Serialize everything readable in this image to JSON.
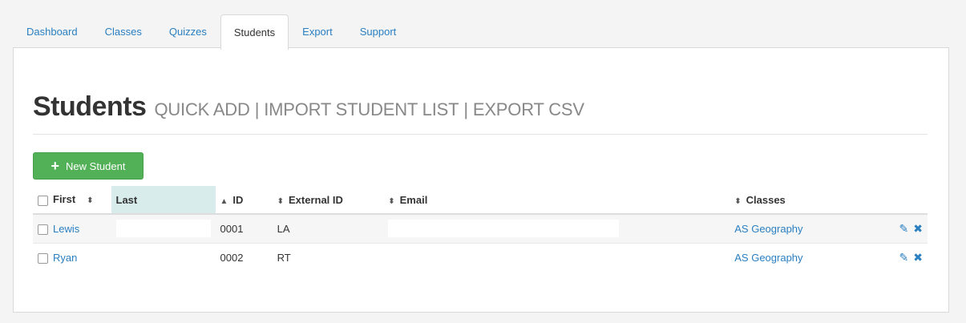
{
  "nav": {
    "tabs": [
      {
        "label": "Dashboard"
      },
      {
        "label": "Classes"
      },
      {
        "label": "Quizzes"
      },
      {
        "label": "Students"
      },
      {
        "label": "Export"
      },
      {
        "label": "Support"
      }
    ],
    "active_tab": "Students"
  },
  "header": {
    "title": "Students",
    "links": [
      "QUICK ADD",
      "IMPORT STUDENT LIST",
      "EXPORT CSV"
    ]
  },
  "toolbar": {
    "new_student_label": "New Student",
    "new_student_icon": "plus-icon",
    "button_color": "#52b157"
  },
  "table": {
    "columns": [
      "First",
      "Last",
      "ID",
      "External ID",
      "Email",
      "Classes"
    ],
    "sorted_column": "Last",
    "sort_icons": {
      "sortable": "⬍",
      "ascending": "▲"
    },
    "rows": [
      {
        "first": "Lewis",
        "last": "",
        "id": "0001",
        "external_id": "LA",
        "email": "",
        "classes": "AS Geography"
      },
      {
        "first": "Ryan",
        "last": "",
        "id": "0002",
        "external_id": "RT",
        "email": "",
        "classes": "AS Geography"
      }
    ],
    "row_actions": {
      "edit_icon": "edit-icon",
      "delete_icon": "delete-icon"
    }
  },
  "colors": {
    "link": "#2a7fc1",
    "sorted_header": "#d9ecec"
  }
}
